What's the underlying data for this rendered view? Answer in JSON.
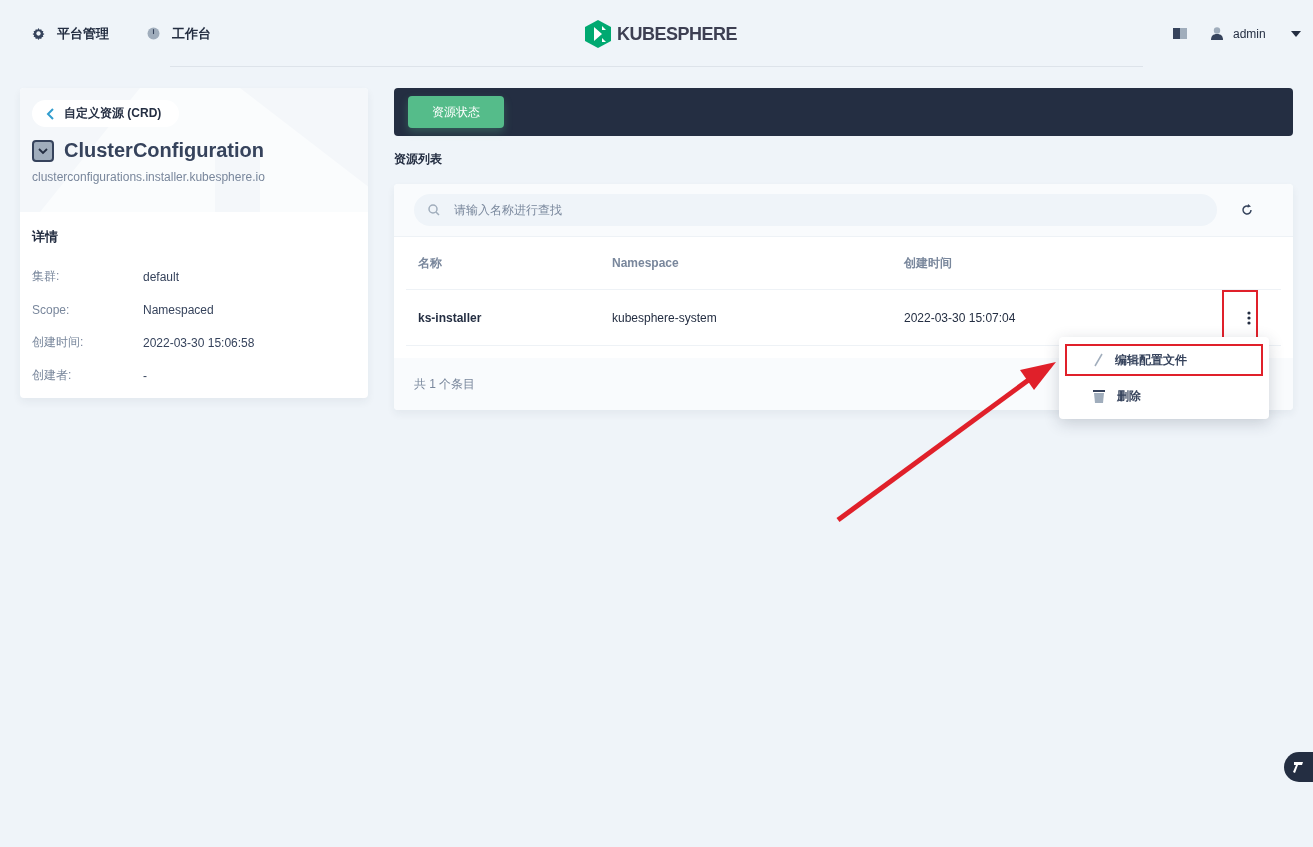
{
  "header": {
    "nav": [
      {
        "label": "平台管理",
        "kind": "gear"
      },
      {
        "label": "工作台",
        "kind": "dial"
      }
    ],
    "logo": "KUBESPHERE",
    "user": "admin"
  },
  "detail": {
    "back": "自定义资源 (CRD)",
    "title": "ClusterConfiguration",
    "subtitle": "clusterconfigurations.installer.kubesphere.io",
    "section": "详情",
    "fields": [
      {
        "label": "集群:",
        "value": "default"
      },
      {
        "label": "Scope:",
        "value": "Namespaced"
      },
      {
        "label": "创建时间:",
        "value": "2022-03-30 15:06:58"
      },
      {
        "label": "创建者:",
        "value": "-"
      }
    ]
  },
  "tabs": [
    {
      "label": "资源状态",
      "selected": true
    }
  ],
  "list_title": "资源列表",
  "search": {
    "placeholder": "请输入名称进行查找"
  },
  "table": {
    "columns": [
      "名称",
      "Namespace",
      "创建时间"
    ],
    "rows": [
      {
        "cells": [
          "ks-installer",
          "kubesphere-system",
          "2022-03-30 15:07:04"
        ]
      }
    ],
    "footer": "共 1 个条目"
  },
  "menu": {
    "items": [
      {
        "label": "编辑配置文件",
        "kind": "edit",
        "highlighted": true
      },
      {
        "label": "删除",
        "kind": "delete",
        "highlighted": false
      }
    ]
  }
}
